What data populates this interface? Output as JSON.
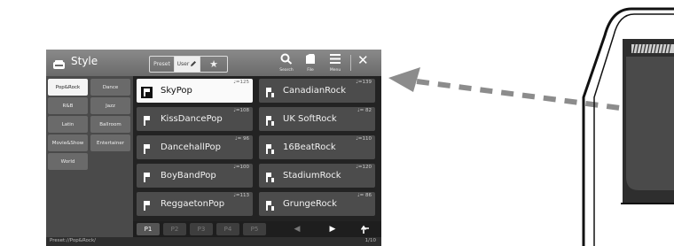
{
  "window": {
    "title": "Style",
    "title_icon": "style-icon"
  },
  "bank_tabs": {
    "preset": "Preset",
    "user": "User",
    "favorite_icon": "star-icon"
  },
  "toolbar": {
    "search_label": "Search",
    "file_label": "File",
    "menu_label": "Menu",
    "close_icon": "close-icon"
  },
  "categories": [
    {
      "label": "Pop&Rock",
      "selected": true
    },
    {
      "label": "Dance",
      "selected": false
    },
    {
      "label": "R&B",
      "selected": false
    },
    {
      "label": "Jazz",
      "selected": false
    },
    {
      "label": "Latin",
      "selected": false
    },
    {
      "label": "Ballroom",
      "selected": false
    },
    {
      "label": "Movie&Show",
      "selected": false
    },
    {
      "label": "Entertainer",
      "selected": false
    },
    {
      "label": "World",
      "selected": false
    }
  ],
  "styles": [
    {
      "name": "SkyPop",
      "tempo": "♩=125",
      "selected": true
    },
    {
      "name": "CanadianRock",
      "tempo": "♩=139",
      "selected": false
    },
    {
      "name": "KissDancePop",
      "tempo": "♩=108",
      "selected": false
    },
    {
      "name": "UK SoftRock",
      "tempo": "♩= 82",
      "selected": false
    },
    {
      "name": "DancehallPop",
      "tempo": "♩= 96",
      "selected": false
    },
    {
      "name": "16BeatRock",
      "tempo": "♩=110",
      "selected": false
    },
    {
      "name": "BoyBandPop",
      "tempo": "♩=100",
      "selected": false
    },
    {
      "name": "StadiumRock",
      "tempo": "♩=120",
      "selected": false
    },
    {
      "name": "ReggaetonPop",
      "tempo": "♩=113",
      "selected": false
    },
    {
      "name": "GrungeRock",
      "tempo": "♩= 86",
      "selected": false
    }
  ],
  "pages": {
    "buttons": [
      "P1",
      "P2",
      "P3",
      "P4",
      "P5"
    ],
    "current": "P1",
    "prev_icon": "previous-page-icon",
    "next_icon": "next-page-icon",
    "up_icon": "up-folder-icon"
  },
  "status": {
    "path": "Preset://Pop&Rock/",
    "page": "1/10"
  },
  "colors": {
    "selected_bg": "#fafafa",
    "arrow": "#8c8c8c"
  }
}
